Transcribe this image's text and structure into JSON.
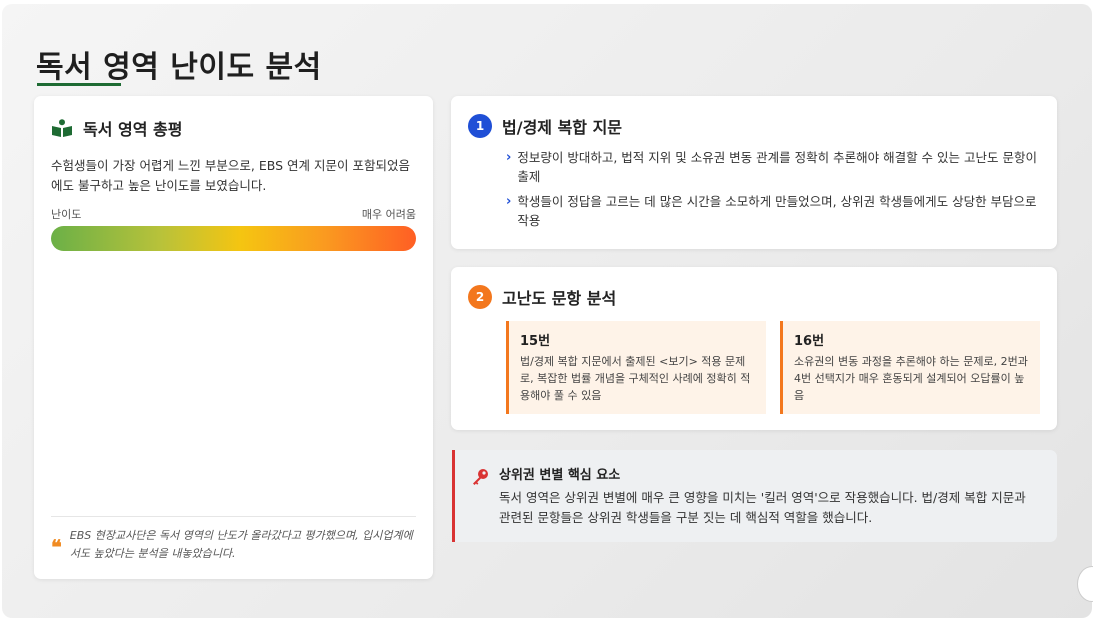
{
  "slide": {
    "title": "독서 영역 난이도 분석"
  },
  "overview": {
    "heading": "독서 영역 총평",
    "summary": "수험생들이 가장 어렵게 느낀 부분으로, EBS 연계 지문이 포함되었음에도 불구하고 높은 난이도를 보였습니다.",
    "difficulty_label_left": "난이도",
    "difficulty_label_right": "매우 어려움",
    "difficulty_level": 1.0,
    "quote": "EBS 현장교사단은 독서 영역의 난도가 올라갔다고 평가했으며, 입시업계에서도 높았다는 분석을 내놓았습니다."
  },
  "section1": {
    "number": "1",
    "heading": "법/경제 복합 지문",
    "bullets": [
      "정보량이 방대하고, 법적 지위 및 소유권 변동 관계를 정확히 추론해야 해결할 수 있는 고난도 문항이 출제",
      "학생들이 정답을 고르는 데 많은 시간을 소모하게 만들었으며, 상위권 학생들에게도 상당한 부담으로 작용"
    ]
  },
  "section2": {
    "number": "2",
    "heading": "고난도 문항 분석",
    "problems": [
      {
        "title": "15번",
        "desc": "법/경제 복합 지문에서 출제된 <보기> 적용 문제로, 복잡한 법률 개념을 구체적인 사례에 정확히 적용해야 풀 수 있음"
      },
      {
        "title": "16번",
        "desc": "소유권의 변동 과정을 추론해야 하는 문제로, 2번과 4번 선택지가 매우 혼동되게 설계되어 오답률이 높음"
      }
    ]
  },
  "key_point": {
    "heading": "상위권 변별 핵심 요소",
    "text": "독서 영역은 상위권 변별에 매우 큰 영향을 미치는 '킬러 영역'으로 작용했습니다. 법/경제 복합 지문과 관련된 문항들은 상위권 학생들을 구분 짓는 데 핵심적 역할을 했습니다."
  },
  "icons": {
    "overview": "book-reader-icon",
    "quote": "quote-icon",
    "key": "key-icon",
    "bullet": "chevron-right-icon"
  },
  "colors": {
    "title_underline": "#1e6b33",
    "section1_badge": "#1f4fd6",
    "section2_badge": "#f3771d",
    "key_border": "#d93333"
  }
}
